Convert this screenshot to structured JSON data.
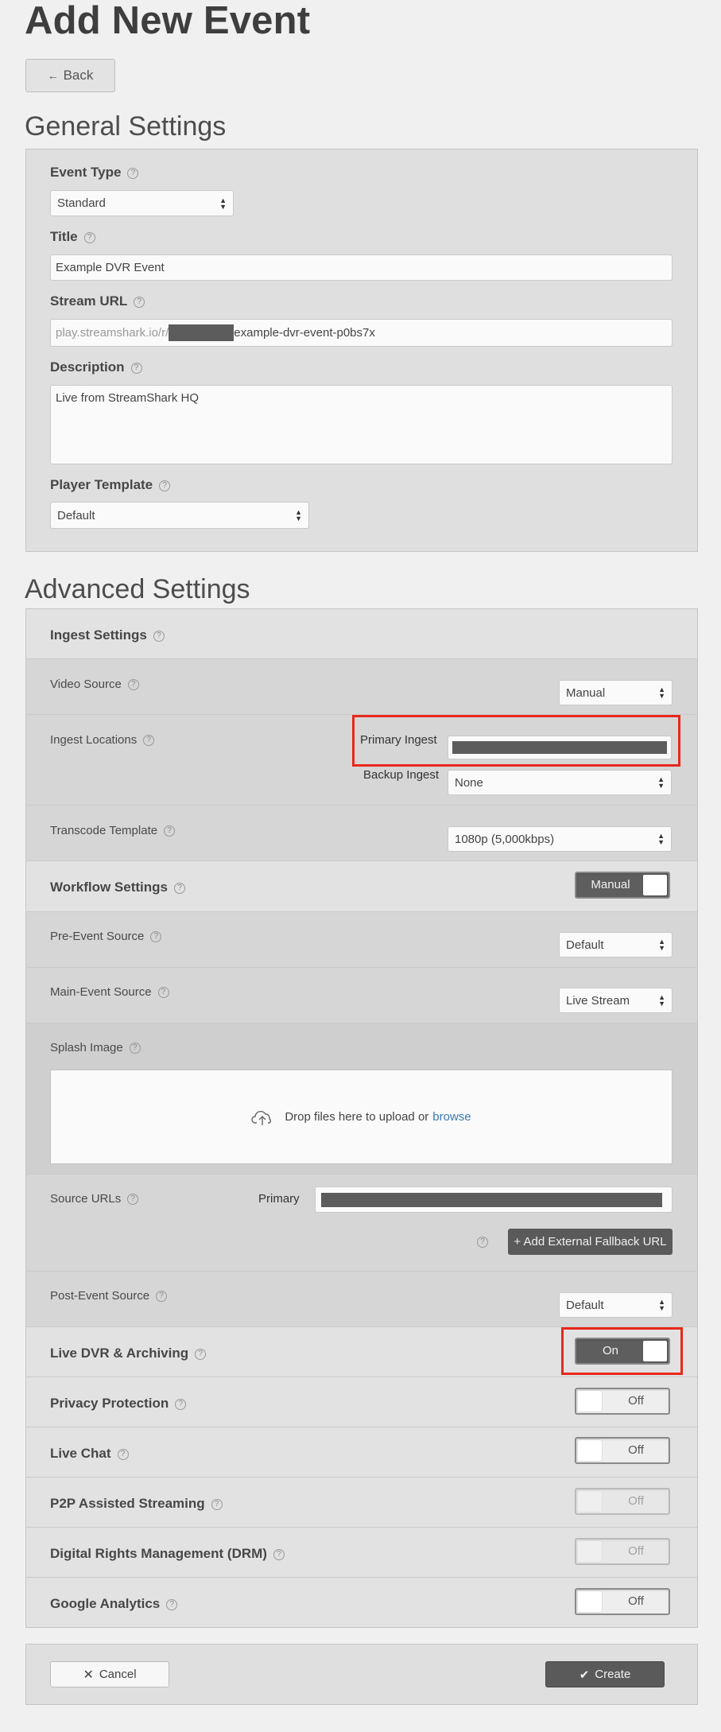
{
  "page": {
    "title": "Add New Event"
  },
  "nav": {
    "back_label": "Back",
    "back_icon": "arrow-left-icon"
  },
  "general": {
    "heading": "General Settings",
    "event_type": {
      "label": "Event Type",
      "value": "Standard"
    },
    "title": {
      "label": "Title",
      "value": "Example DVR Event"
    },
    "stream_url": {
      "label": "Stream URL",
      "prefix": "play.streamshark.io/r/",
      "suffix": "example-dvr-event-p0bs7x"
    },
    "description": {
      "label": "Description",
      "value": "Live from StreamShark HQ"
    },
    "player_template": {
      "label": "Player Template",
      "value": "Default"
    }
  },
  "advanced": {
    "heading": "Advanced Settings",
    "ingest_settings": {
      "label": "Ingest Settings"
    },
    "video_source": {
      "label": "Video Source",
      "value": "Manual"
    },
    "ingest_locations": {
      "label": "Ingest Locations",
      "primary_label": "Primary Ingest",
      "backup_label": "Backup Ingest",
      "backup_value": "None"
    },
    "transcode_template": {
      "label": "Transcode Template",
      "value": "1080p (5,000kbps)"
    },
    "workflow_settings": {
      "label": "Workflow Settings",
      "toggle": "Manual"
    },
    "pre_event_source": {
      "label": "Pre-Event Source",
      "value": "Default"
    },
    "main_event_source": {
      "label": "Main-Event Source",
      "value": "Live Stream"
    },
    "splash_image": {
      "label": "Splash Image",
      "drop_text": "Drop files here to upload or",
      "browse": "browse"
    },
    "source_urls": {
      "label": "Source URLs",
      "primary_label": "Primary",
      "add_fallback": "+ Add External Fallback URL"
    },
    "post_event_source": {
      "label": "Post-Event Source",
      "value": "Default"
    },
    "live_dvr": {
      "label": "Live DVR & Archiving",
      "toggle": "On"
    },
    "privacy_protection": {
      "label": "Privacy Protection",
      "toggle": "Off"
    },
    "live_chat": {
      "label": "Live Chat",
      "toggle": "Off"
    },
    "p2p": {
      "label": "P2P Assisted Streaming",
      "toggle": "Off"
    },
    "drm": {
      "label": "Digital Rights Management (DRM)",
      "toggle": "Off"
    },
    "google_analytics": {
      "label": "Google Analytics",
      "toggle": "Off"
    }
  },
  "footer": {
    "cancel_label": "Cancel",
    "create_label": "Create"
  },
  "help_glyph": "?",
  "colors": {
    "highlight": "#e8281c",
    "toggle_on": "#5e5e5e",
    "link": "#3a7ab5",
    "create_button": "#5a5a5a"
  }
}
